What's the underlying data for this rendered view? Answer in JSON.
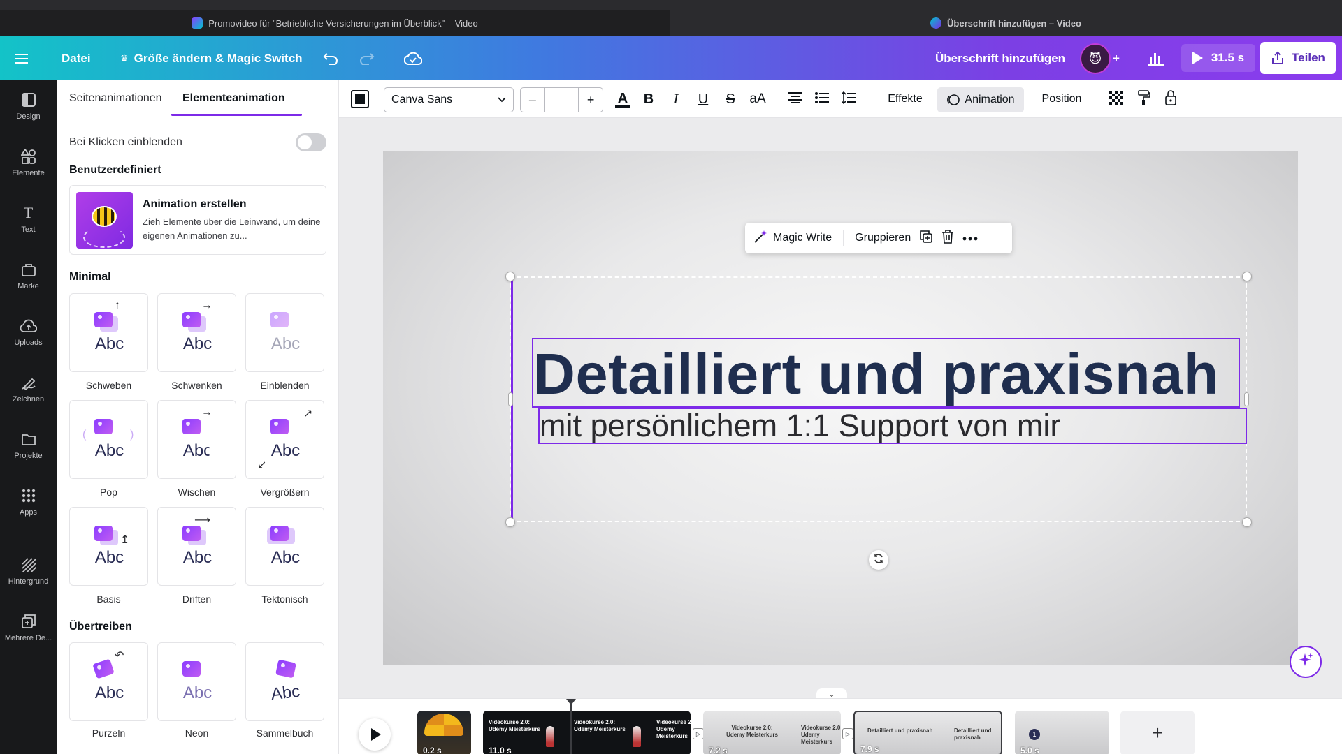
{
  "browser": {
    "tab1_title": "Promovideo für \"Betriebliche Versicherungen im Überblick\" – Video",
    "tab2_title": "Überschrift hinzufügen – Video"
  },
  "header": {
    "file_label": "Datei",
    "resize_label": "Größe ändern & Magic Switch",
    "doc_title": "Überschrift hinzufügen",
    "play_duration": "31.5 s",
    "share_label": "Teilen",
    "gradient": [
      "#13c3c8",
      "#7c3fe4"
    ]
  },
  "rail": {
    "items": [
      {
        "label": "Design",
        "icon": "design-icon"
      },
      {
        "label": "Elemente",
        "icon": "elements-icon"
      },
      {
        "label": "Text",
        "icon": "text-icon"
      },
      {
        "label": "Marke",
        "icon": "brand-icon"
      },
      {
        "label": "Uploads",
        "icon": "upload-icon"
      },
      {
        "label": "Zeichnen",
        "icon": "draw-icon"
      },
      {
        "label": "Projekte",
        "icon": "folder-icon"
      },
      {
        "label": "Apps",
        "icon": "apps-icon"
      },
      {
        "label": "Hintergrund",
        "icon": "background-icon"
      },
      {
        "label": "Mehrere De...",
        "icon": "multi-design-icon"
      }
    ]
  },
  "panel": {
    "tabs": [
      "Seitenanimationen",
      "Elementeanimation"
    ],
    "active_tab": "Elementeanimation",
    "toggle_label": "Bei Klicken einblenden",
    "toggle_on": false,
    "custom_heading": "Benutzerdefiniert",
    "custom_card": {
      "title": "Animation erstellen",
      "desc": "Zieh Elemente über die Leinwand, um deine eigenen Animationen zu..."
    },
    "minimal_heading": "Minimal",
    "minimal": [
      {
        "label": "Schweben",
        "abc": "Abc"
      },
      {
        "label": "Schwenken",
        "abc": "Abc"
      },
      {
        "label": "Einblenden",
        "abc": "Abc"
      },
      {
        "label": "Pop",
        "abc": "Abc"
      },
      {
        "label": "Wischen",
        "abc": "Abc"
      },
      {
        "label": "Vergrößern",
        "abc": "Abc"
      },
      {
        "label": "Basis",
        "abc": "Abc"
      },
      {
        "label": "Driften",
        "abc": "Abc"
      },
      {
        "label": "Tektonisch",
        "abc": "Abc"
      }
    ],
    "exaggerate_heading": "Übertreiben",
    "exaggerate": [
      {
        "label": "Purzeln",
        "abc": "Abc"
      },
      {
        "label": "Neon",
        "abc": "Abc"
      },
      {
        "label": "Sammelbuch",
        "abc": "Abc"
      }
    ]
  },
  "toolbar": {
    "font": "Canva Sans",
    "size_minus": "–",
    "size_value": "– –",
    "size_plus": "+",
    "text_color_glyph": "A",
    "bold": "B",
    "italic": "I",
    "underline": "U",
    "strike": "S",
    "case": "aA",
    "effects": "Effekte",
    "animation": "Animation",
    "position": "Position"
  },
  "canvas": {
    "context_bar": {
      "magic_write": "Magic Write",
      "group": "Gruppieren"
    },
    "headline": "Detailliert und praxisnah",
    "subline": "mit persönlichem 1:1 Support von mir",
    "headline_color": "#1f2e4f",
    "selection_color": "#7d2ae8"
  },
  "timeline": {
    "clips": [
      {
        "duration": "0.2 s"
      },
      {
        "duration": "11.0 s",
        "mini_text": "Videokurse 2.0: Udemy Meisterkurs"
      },
      {
        "duration": "7.2 s",
        "mini_text": "Videokurse 2.0: Udemy Meisterkurs"
      },
      {
        "duration": "7.9 s",
        "mini_text": "Detailliert und praxisnah"
      },
      {
        "duration": "5.0 s"
      }
    ],
    "add_label": "+"
  }
}
